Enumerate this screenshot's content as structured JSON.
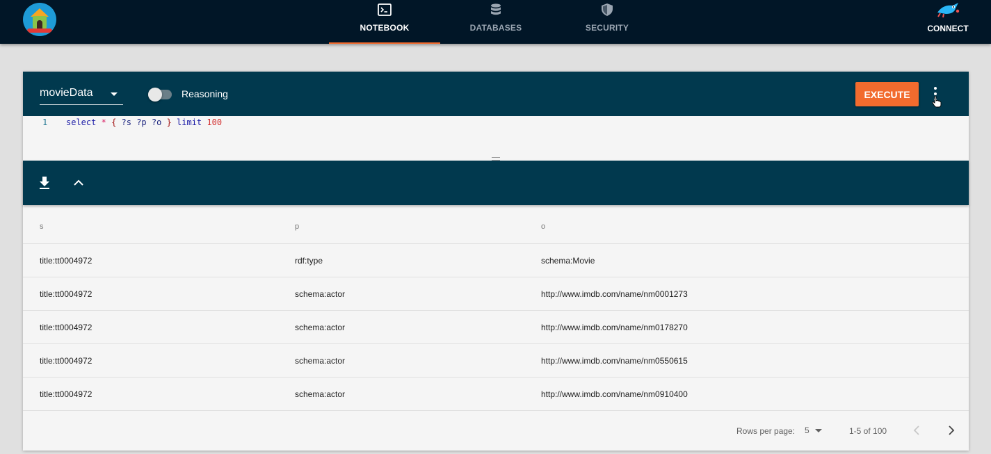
{
  "nav": {
    "tabs": [
      {
        "label": "NOTEBOOK",
        "icon": "terminal-icon",
        "active": true
      },
      {
        "label": "DATABASES",
        "icon": "database-icon",
        "active": false
      },
      {
        "label": "SECURITY",
        "icon": "shield-icon",
        "active": false
      }
    ],
    "connect_label": "CONNECT"
  },
  "editor": {
    "database": "movieData",
    "reasoning_label": "Reasoning",
    "reasoning_on": false,
    "execute_label": "EXECUTE",
    "line_number": "1",
    "query_tokens": {
      "select": "select",
      "star": "*",
      "open": "{",
      "vars": "?s ?p ?o",
      "close": "}",
      "limit": "limit",
      "count": "100"
    }
  },
  "results": {
    "columns": [
      "s",
      "p",
      "o"
    ],
    "rows": [
      [
        "title:tt0004972",
        "rdf:type",
        "schema:Movie"
      ],
      [
        "title:tt0004972",
        "schema:actor",
        "http://www.imdb.com/name/nm0001273"
      ],
      [
        "title:tt0004972",
        "schema:actor",
        "http://www.imdb.com/name/nm0178270"
      ],
      [
        "title:tt0004972",
        "schema:actor",
        "http://www.imdb.com/name/nm0550615"
      ],
      [
        "title:tt0004972",
        "schema:actor",
        "http://www.imdb.com/name/nm0910400"
      ]
    ],
    "pagination": {
      "rows_per_page_label": "Rows per page:",
      "rows_per_page": "5",
      "range": "1-5 of 100"
    }
  },
  "colors": {
    "nav_bg": "#011627",
    "header_bg": "#01394e",
    "accent": "#f26b2e"
  }
}
